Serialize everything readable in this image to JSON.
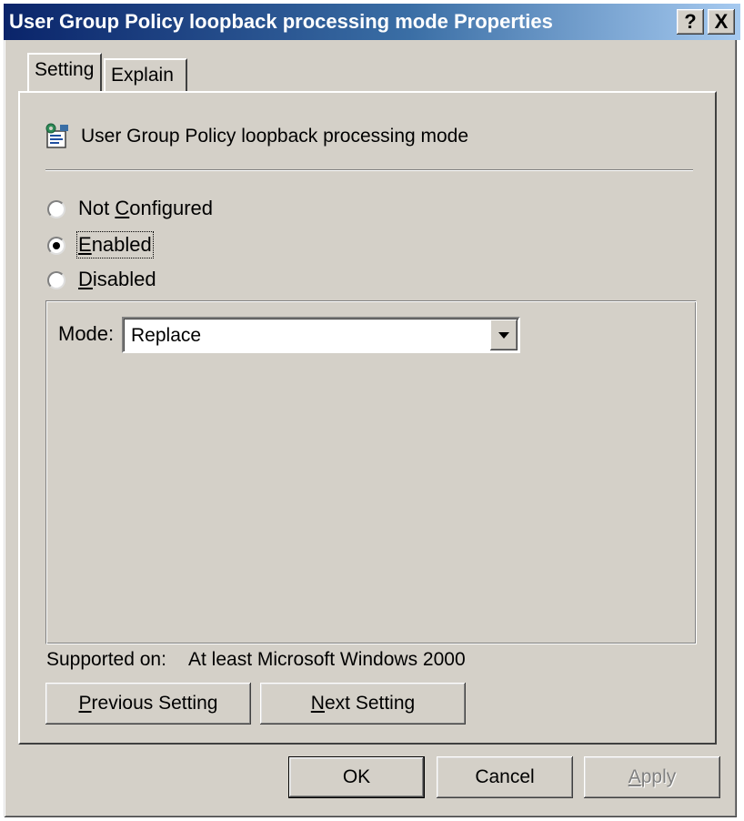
{
  "window": {
    "title": "User Group Policy loopback processing mode Properties",
    "help_label": "?",
    "close_label": "X"
  },
  "tabs": [
    {
      "label": "Setting",
      "selected": true
    },
    {
      "label": "Explain",
      "selected": false
    }
  ],
  "policy": {
    "icon": "policy-settings-icon",
    "title": "User Group Policy loopback processing mode"
  },
  "state_options": [
    {
      "pre": "Not ",
      "key": "C",
      "post": "onfigured",
      "selected": false
    },
    {
      "pre": "",
      "key": "E",
      "post": "nabled",
      "selected": true
    },
    {
      "pre": "",
      "key": "D",
      "post": "isabled",
      "selected": false
    }
  ],
  "mode": {
    "label": "Mode:",
    "value": "Replace"
  },
  "supported": {
    "label": "Supported on:",
    "value": "At least Microsoft Windows 2000"
  },
  "nav_buttons": {
    "previous": {
      "pre": "",
      "key": "P",
      "post": "revious Setting"
    },
    "next": {
      "pre": "",
      "key": "N",
      "post": "ext Setting"
    }
  },
  "dialog_buttons": {
    "ok": "OK",
    "cancel": "Cancel",
    "apply": {
      "pre": "",
      "key": "A",
      "post": "pply",
      "enabled": false
    }
  },
  "colors": {
    "face": "#d4d0c8",
    "title_start": "#0a246a",
    "title_end": "#a6caf0"
  }
}
